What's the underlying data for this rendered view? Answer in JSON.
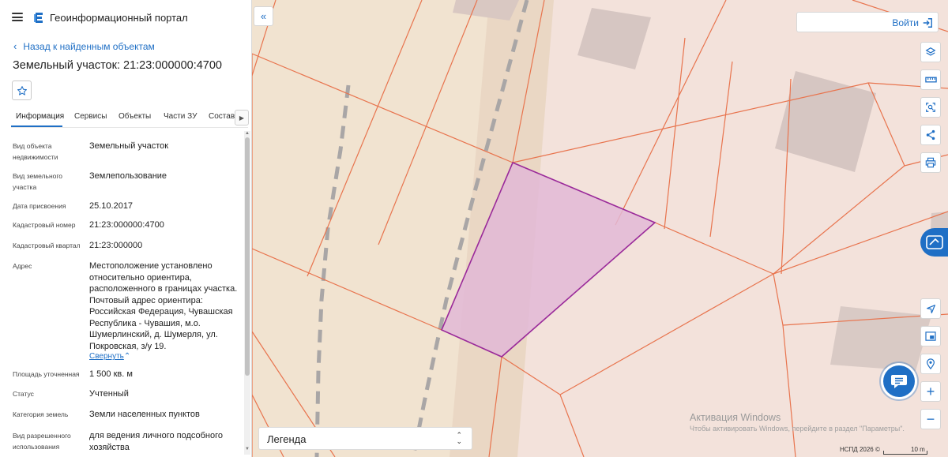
{
  "header": {
    "portal_title": "Геоинформационный портал",
    "back_link": "Назад к найденным объектам",
    "object_title": "Земельный участок: 21:23:000000:4700"
  },
  "tabs": [
    {
      "label": "Информация",
      "active": true
    },
    {
      "label": "Сервисы",
      "active": false
    },
    {
      "label": "Объекты",
      "active": false
    },
    {
      "label": "Части ЗУ",
      "active": false
    },
    {
      "label": "Состав",
      "active": false
    }
  ],
  "properties": [
    {
      "label": "Вид объекта недвижимости",
      "value": "Земельный участок"
    },
    {
      "label": "Вид земельного участка",
      "value": "Землепользование"
    },
    {
      "label": "Дата присвоения",
      "value": "25.10.2017"
    },
    {
      "label": "Кадастровый номер",
      "value": "21:23:000000:4700"
    },
    {
      "label": "Кадастровый квартал",
      "value": "21:23:000000"
    },
    {
      "label": "Адрес",
      "value": "Местоположение установлено относительно ориентира, расположенного в границах участка. Почтовый адрес ориентира: Российская Федерация, Чувашская Республика - Чувашия, м.о. Шумерлинский, д. Шумерля, ул. Покровская, з/у 19."
    },
    {
      "label": "Площадь уточненная",
      "value": "1 500 кв. м"
    },
    {
      "label": "Статус",
      "value": "Учтенный"
    },
    {
      "label": "Категория земель",
      "value": "Земли населенных пунктов"
    },
    {
      "label": "Вид разрешенного использования",
      "value": "для ведения личного подсобного хозяйства"
    }
  ],
  "address_collapse": "Свернуть",
  "map": {
    "login_label": "Войти",
    "legend_label": "Легенда",
    "attribution": "НСПД 2026 ©",
    "scale_label": "10 m",
    "watermark_title": "Активация Windows",
    "watermark_subtitle": "Чтобы активировать Windows, перейдите в раздел \"Параметры\".",
    "selected_parcel_fill": "#e2b8d6",
    "selected_parcel_stroke": "#9a2a9a",
    "parcel_line_color": "#e8744e",
    "accent_color": "#1f6fc5"
  },
  "icons": {
    "menu": "menu-icon",
    "logo": "portal-logo-icon",
    "favorite": "star-icon",
    "collapse_panel": "double-chevron-left-icon",
    "login": "sign-in-icon",
    "layers": "layers-icon",
    "ruler": "ruler-icon",
    "select_area": "select-area-icon",
    "share": "share-icon",
    "print": "print-icon",
    "side_panel": "side-panel-icon",
    "locate": "locate-icon",
    "minimap": "minimap-icon",
    "pin": "map-pin-icon",
    "zoom_in": "plus-icon",
    "zoom_out": "minus-icon",
    "chat": "chat-icon"
  }
}
